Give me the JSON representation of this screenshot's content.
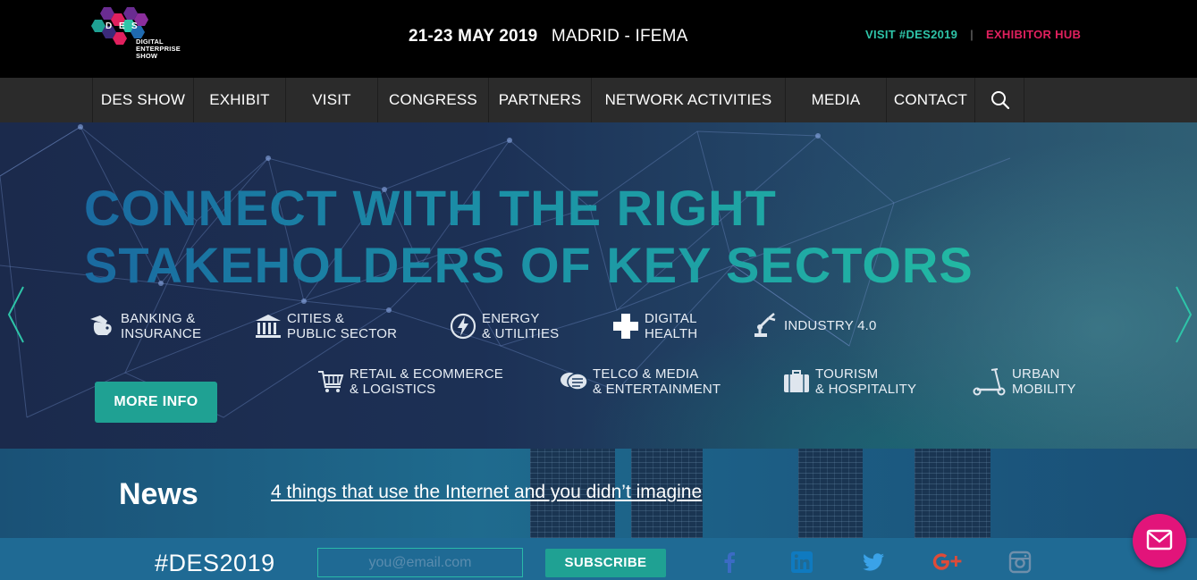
{
  "brand": {
    "logo_letters": "DES",
    "logo_text": "DIGITAL ENTERPRISE SHOW"
  },
  "event": {
    "dates": "21-23 MAY 2019",
    "location": "MADRID - IFEMA"
  },
  "top_links": {
    "visit": "VISIT #DES2019",
    "exhibitor_hub": "EXHIBITOR HUB"
  },
  "nav": {
    "items": [
      {
        "label": "DES SHOW"
      },
      {
        "label": "EXHIBIT"
      },
      {
        "label": "VISIT"
      },
      {
        "label": "CONGRESS"
      },
      {
        "label": "PARTNERS"
      },
      {
        "label": "NETWORK ACTIVITIES"
      },
      {
        "label": "MEDIA"
      },
      {
        "label": "CONTACT"
      }
    ],
    "search_icon": "search-icon"
  },
  "hero": {
    "title_line1": "CONNECT WITH THE RIGHT",
    "title_line2": "STAKEHOLDERS OF KEY SECTORS",
    "sectors": [
      {
        "label": "BANKING &\nINSURANCE",
        "icon": "piggy-bank-icon"
      },
      {
        "label": "CITIES &\nPUBLIC SECTOR",
        "icon": "bank-building-icon"
      },
      {
        "label": "ENERGY\n& UTILITIES",
        "icon": "lightning-icon"
      },
      {
        "label": "DIGITAL\nHEALTH",
        "icon": "medical-cross-icon"
      },
      {
        "label": "INDUSTRY 4.0",
        "icon": "robot-arm-icon"
      },
      {
        "label": "RETAIL & ECOMMERCE\n& LOGISTICS",
        "icon": "shopping-cart-icon"
      },
      {
        "label": "TELCO & MEDIA\n& ENTERTAINMENT",
        "icon": "chat-bubbles-icon"
      },
      {
        "label": "TOURISM\n& HOSPITALITY",
        "icon": "suitcase-icon"
      },
      {
        "label": "URBAN\nMOBILITY",
        "icon": "scooter-icon"
      }
    ],
    "more_info": "MORE INFO"
  },
  "news": {
    "label": "News",
    "headline": "4 things that use the Internet and you didn’t imagine"
  },
  "footer": {
    "hashtag": "#DES2019",
    "email_placeholder": "you@email.com",
    "subscribe": "SUBSCRIBE",
    "social": [
      "facebook-icon",
      "linkedin-icon",
      "twitter-icon",
      "google-plus-icon",
      "instagram-icon"
    ]
  },
  "colors": {
    "accent_teal": "#1fa193",
    "visit_link": "#2ec4a8",
    "exhibitor_link": "#e0205e",
    "mail_button": "#e2147a"
  }
}
